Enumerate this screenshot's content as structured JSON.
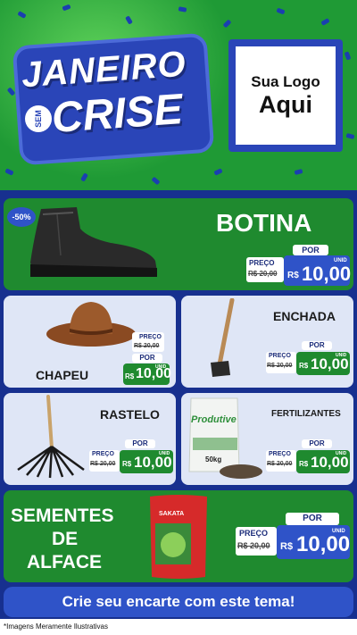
{
  "header": {
    "title_line1": "JANEIRO",
    "title_sem": "SEM",
    "title_line2": "CRISE",
    "logo_line1": "Sua Logo",
    "logo_line2": "Aqui"
  },
  "colors": {
    "green": "#1f8a2f",
    "blue": "#17308f",
    "accent_blue": "#2f53c8"
  },
  "products": [
    {
      "name": "BOTINA",
      "badge": "-50%",
      "por": "POR",
      "preco": "PREÇO",
      "old_price": "R$ 20,00",
      "currency": "R$",
      "price": "10,00",
      "unit": "UNID",
      "icon": "boot-icon"
    },
    {
      "name": "CHAPEU",
      "por": "POR",
      "preco": "PREÇO",
      "old_price": "R$ 20,00",
      "currency": "R$",
      "price": "10,00",
      "unit": "UNID",
      "icon": "hat-icon"
    },
    {
      "name": "ENCHADA",
      "por": "POR",
      "preco": "PREÇO",
      "old_price": "R$ 20,00",
      "currency": "R$",
      "price": "10,00",
      "unit": "UNID",
      "icon": "hoe-icon"
    },
    {
      "name": "RASTELO",
      "por": "POR",
      "preco": "PREÇO",
      "old_price": "R$ 20,00",
      "currency": "R$",
      "price": "10,00",
      "unit": "UNID",
      "icon": "rake-icon"
    },
    {
      "name": "FERTILIZANTES",
      "por": "POR",
      "preco": "PREÇO",
      "old_price": "R$ 20,00",
      "currency": "R$",
      "price": "10,00",
      "unit": "UNID",
      "icon": "fertilizer-bag-icon",
      "bag_brand": "Produtive",
      "bag_weight": "50kg"
    },
    {
      "name_l1": "SEMENTES",
      "name_l2": "DE",
      "name_l3": "ALFACE",
      "por": "POR",
      "preco": "PREÇO",
      "old_price": "R$ 20,00",
      "currency": "R$",
      "price": "10,00",
      "unit": "UNID",
      "icon": "seed-packet-icon",
      "packet_brand": "SAKATA"
    }
  ],
  "footer": {
    "cta": "Crie seu encarte com este tema!",
    "note": "*Imagens Meramente Ilustrativas"
  }
}
